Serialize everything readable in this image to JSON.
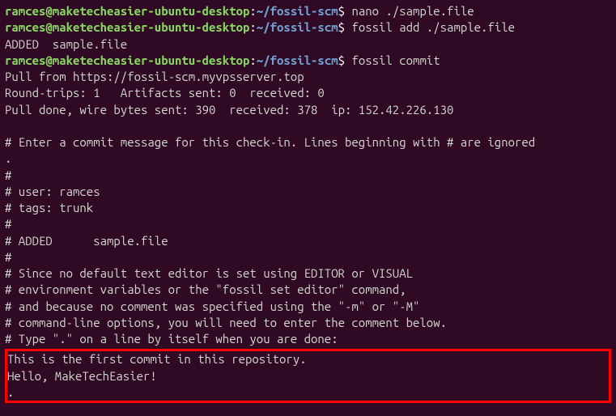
{
  "prompt": {
    "user": "ramces@maketecheasier-ubuntu-desktop",
    "colon": ":",
    "path": "~/fossil-scm",
    "dollar": "$ "
  },
  "commands": {
    "cmd1": "nano ./sample.file",
    "cmd2": "fossil add ./sample.file",
    "cmd3": "fossil commit"
  },
  "output": {
    "added": "ADDED  sample.file",
    "pull_from": "Pull from https://fossil-scm.myvpsserver.top",
    "round_trips": "Round-trips: 1   Artifacts sent: 0  received: 0",
    "pull_done": "Pull done, wire bytes sent: 390  received: 378  ip: 152.42.226.130",
    "blank1": " ",
    "comment1": "# Enter a commit message for this check-in. Lines beginning with # are ignored",
    "dot1": ".",
    "hash1": "#",
    "user_line": "# user: ramces",
    "tags_line": "# tags: trunk",
    "hash2": "#",
    "added_line": "# ADDED      sample.file",
    "hash3": "#",
    "editor1": "# Since no default text editor is set using EDITOR or VISUAL",
    "editor2": "# environment variables or the \"fossil set editor\" command,",
    "editor3": "# and because no comment was specified using the \"-m\" or \"-M\"",
    "editor4": "# command-line options, you will need to enter the comment below.",
    "editor5": "# Type \".\" on a line by itself when you are done:"
  },
  "input": {
    "line1": "This is the first commit in this repository.",
    "line2": "Hello, MakeTechEasier!",
    "line3": "."
  }
}
